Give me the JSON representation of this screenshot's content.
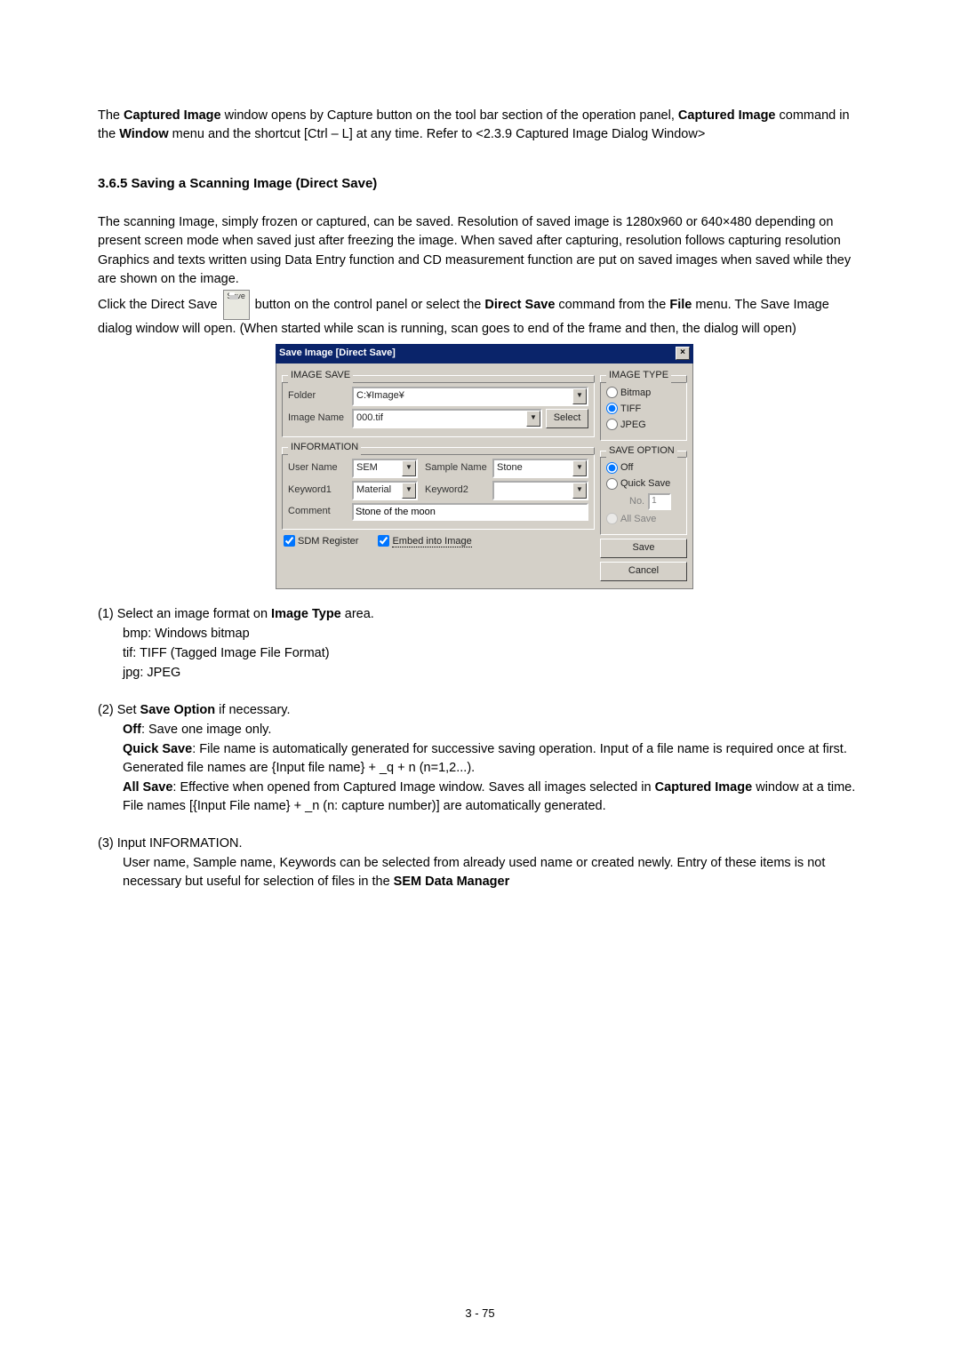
{
  "intro": {
    "p1a": "The ",
    "p1b": "Captured Image",
    "p1c": " window opens by Capture button on the tool bar section of the operation panel, ",
    "p1d": "Captured Image",
    "p1e": " command in the ",
    "p1f": "Window",
    "p1g": " menu and the shortcut [Ctrl – L] at any time. Refer to <2.3.9 Captured Image Dialog Window>"
  },
  "section_title": "3.6.5   Saving a Scanning Image (Direct Save)",
  "para2": {
    "l1": "The scanning Image, simply frozen or captured, can be saved. Resolution of saved image is 1280x960 or 640×480 depending on present screen mode when saved just after freezing the image. When saved after capturing, resolution follows capturing resolution",
    "l2": "Graphics and texts written using Data Entry function and CD measurement function are put on saved images when saved while they are shown on the image.",
    "l3a": "Click the Direct Save ",
    "l3b": " button on the control panel or select the ",
    "l3c": "Direct Save",
    "l3d": " command from the ",
    "l3e": "File",
    "l3f": " menu. The Save Image dialog window will open. (When started while scan is running, scan goes to end of the frame and then, the dialog will open)"
  },
  "icon": {
    "label": "Save"
  },
  "dialog": {
    "title": "Save Image [Direct Save]",
    "close": "×",
    "image_save": {
      "legend": "IMAGE SAVE",
      "folder_label": "Folder",
      "folder_value": "C:¥Image¥",
      "imagename_label": "Image Name",
      "imagename_value": "000.tif",
      "select_btn": "Select"
    },
    "information": {
      "legend": "INFORMATION",
      "username_label": "User Name",
      "username_value": "SEM",
      "samplename_label": "Sample Name",
      "samplename_value": "Stone",
      "keyword1_label": "Keyword1",
      "keyword1_value": "Material",
      "keyword2_label": "Keyword2",
      "keyword2_value": "",
      "comment_label": "Comment",
      "comment_value": "Stone of the moon"
    },
    "image_type": {
      "legend": "IMAGE TYPE",
      "bitmap": "Bitmap",
      "tiff": "TIFF",
      "jpeg": "JPEG"
    },
    "save_option": {
      "legend": "SAVE OPTION",
      "off": "Off",
      "quick": "Quick Save",
      "no_label": "No.",
      "no_value": "1",
      "all": "All Save"
    },
    "buttons": {
      "save": "Save",
      "cancel": "Cancel",
      "sdm": "SDM Register",
      "embed": "Embed into Image"
    }
  },
  "step1": {
    "head_a": "(1) Select an image format on ",
    "head_b": "Image Type",
    "head_c": " area.",
    "bmp": "bmp: Windows bitmap",
    "tif": "tif: TIFF (Tagged Image File Format)",
    "jpg": "jpg: JPEG"
  },
  "step2": {
    "head_a": "(2) Set ",
    "head_b": "Save Option",
    "head_c": " if necessary.",
    "off_a": "Off",
    "off_b": ": Save one image only.",
    "qs_a": "Quick Save",
    "qs_b": ": File name is automatically generated for successive saving operation. Input of a file name is required once at first. Generated file names are {Input file name} + _q + n (n=1,2...).",
    "as_a": "All Save",
    "as_b": ": Effective when opened from Captured Image window. Saves all images selected in ",
    "as_c": "Captured Image",
    "as_d": " window at a time. File names [{Input File name} + _n (n: capture number)] are automatically generated."
  },
  "step3": {
    "head": "(3) Input INFORMATION.",
    "body_a": "User name, Sample name, Keywords can be selected from already used name or created newly. Entry of these items is not necessary but useful for selection of files in the ",
    "body_b": "SEM Data Manager"
  },
  "pagefoot": "3 - 75"
}
